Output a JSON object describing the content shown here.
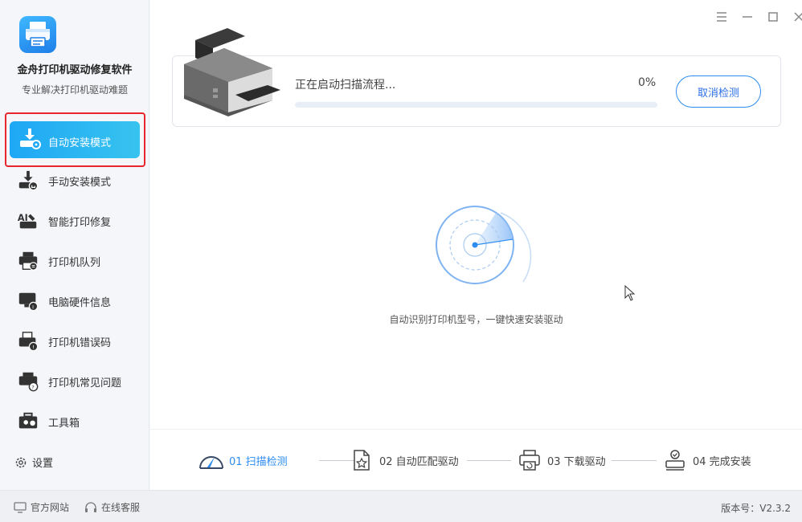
{
  "app": {
    "name": "金舟打印机驱动修复软件",
    "subtitle": "专业解决打印机驱动难题"
  },
  "sidebar": {
    "items": [
      {
        "label": "自动安装模式",
        "icon": "auto-install-icon",
        "active": true
      },
      {
        "label": "手动安装模式",
        "icon": "manual-install-icon"
      },
      {
        "label": "智能打印修复",
        "icon": "ai-repair-icon"
      },
      {
        "label": "打印机队列",
        "icon": "printer-queue-icon"
      },
      {
        "label": "电脑硬件信息",
        "icon": "hardware-info-icon"
      },
      {
        "label": "打印机错误码",
        "icon": "error-code-icon"
      },
      {
        "label": "打印机常见问题",
        "icon": "faq-icon"
      },
      {
        "label": "工具箱",
        "icon": "toolbox-icon"
      }
    ],
    "settings_label": "设置"
  },
  "scan": {
    "status_text": "正在启动扫描流程...",
    "percent_text": "0%",
    "progress": 0,
    "cancel_label": "取消检测",
    "hint": "自动识别打印机型号，一键快速安装驱动"
  },
  "steps": [
    {
      "label": "01 扫描检测",
      "active": true
    },
    {
      "label": "02 自动匹配驱动",
      "active": false
    },
    {
      "label": "03 下载驱动",
      "active": false
    },
    {
      "label": "04 完成安装",
      "active": false
    }
  ],
  "footer": {
    "website_label": "官方网站",
    "service_label": "在线客服",
    "version_text": "版本号：V2.3.2"
  },
  "colors": {
    "accent": "#2d8cf0",
    "active_pill": "#1ea7f5",
    "highlight_border": "#e8262d"
  }
}
